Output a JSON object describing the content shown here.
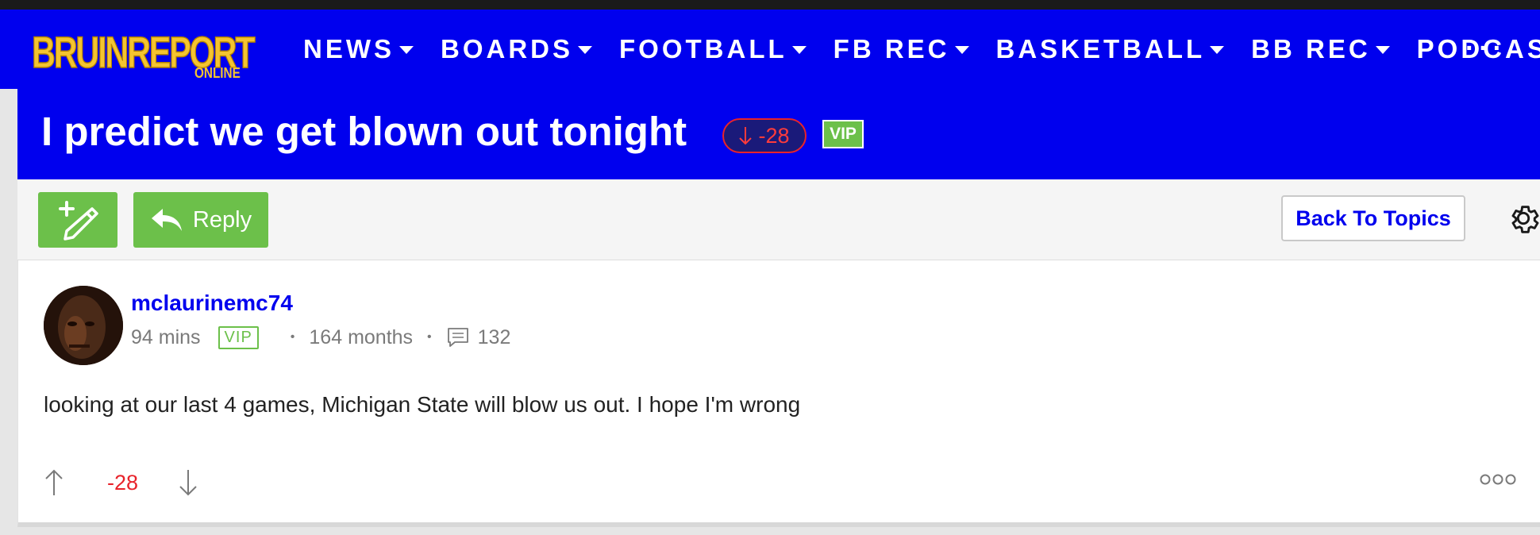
{
  "header": {
    "logo_text": "BRUINREPORT",
    "logo_sub": "ONLINE",
    "nav": [
      {
        "label": "NEWS",
        "has_dropdown": true
      },
      {
        "label": "BOARDS",
        "has_dropdown": true
      },
      {
        "label": "FOOTBALL",
        "has_dropdown": true
      },
      {
        "label": "FB REC",
        "has_dropdown": true
      },
      {
        "label": "BASKETBALL",
        "has_dropdown": true
      },
      {
        "label": "BB REC",
        "has_dropdown": true
      },
      {
        "label": "PODCASTS",
        "has_dropdown": false
      }
    ],
    "more_label": "···"
  },
  "thread": {
    "title": "I predict we get blown out tonight",
    "vote_score": "-28",
    "badge": "VIP"
  },
  "toolbar": {
    "reply_label": "Reply",
    "back_label": "Back To Topics"
  },
  "post": {
    "username": "mclaurinemc74",
    "time_ago": "94 mins",
    "vip_label": "VIP",
    "member_duration": "164 months",
    "comment_count": "132",
    "body": "looking at our last 4 games, Michigan State will blow us out. I hope I'm wrong",
    "score": "-28"
  },
  "colors": {
    "brand_blue": "#0000ee",
    "accent_green": "#6cc04a",
    "negative_red": "#e8232b",
    "logo_gold": "#f4c430"
  },
  "icons": [
    "new-post-icon",
    "reply-arrow-icon",
    "gear-icon",
    "comment-icon",
    "arrow-up-icon",
    "arrow-down-icon",
    "more-options-icon",
    "chevron-down-icon"
  ]
}
